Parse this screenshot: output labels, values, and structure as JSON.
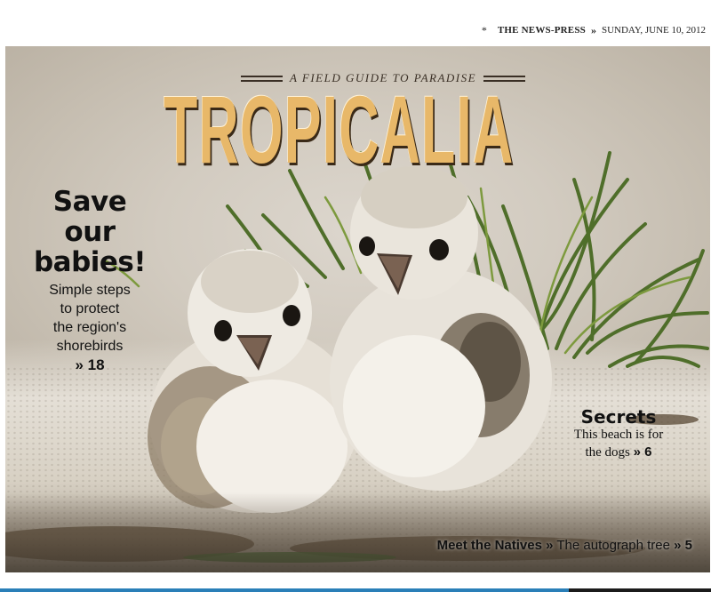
{
  "dateline": {
    "star": "*",
    "paper": "THE NEWS-PRESS",
    "separator": "»",
    "date": "SUNDAY, JUNE 10, 2012"
  },
  "masthead": {
    "tagline": "A FIELD GUIDE TO PARADISE",
    "title": "TROPICALIA"
  },
  "stories": {
    "save": {
      "headline": [
        "Save",
        "our",
        "babies!"
      ],
      "subhead": [
        "Simple steps",
        "to protect",
        "the region's",
        "shorebirds"
      ],
      "page_ref": "» 18"
    },
    "secrets": {
      "headline": "Secrets",
      "line1": "This beach is for",
      "line2": "the dogs",
      "page_ref": "» 6"
    },
    "natives": {
      "label": "Meet the Natives",
      "arrow": "»",
      "desc": "The autograph tree",
      "page_ref": "» 5"
    }
  },
  "colors": {
    "title": "#e8b869",
    "accent_strip": "#2a7fb8"
  }
}
